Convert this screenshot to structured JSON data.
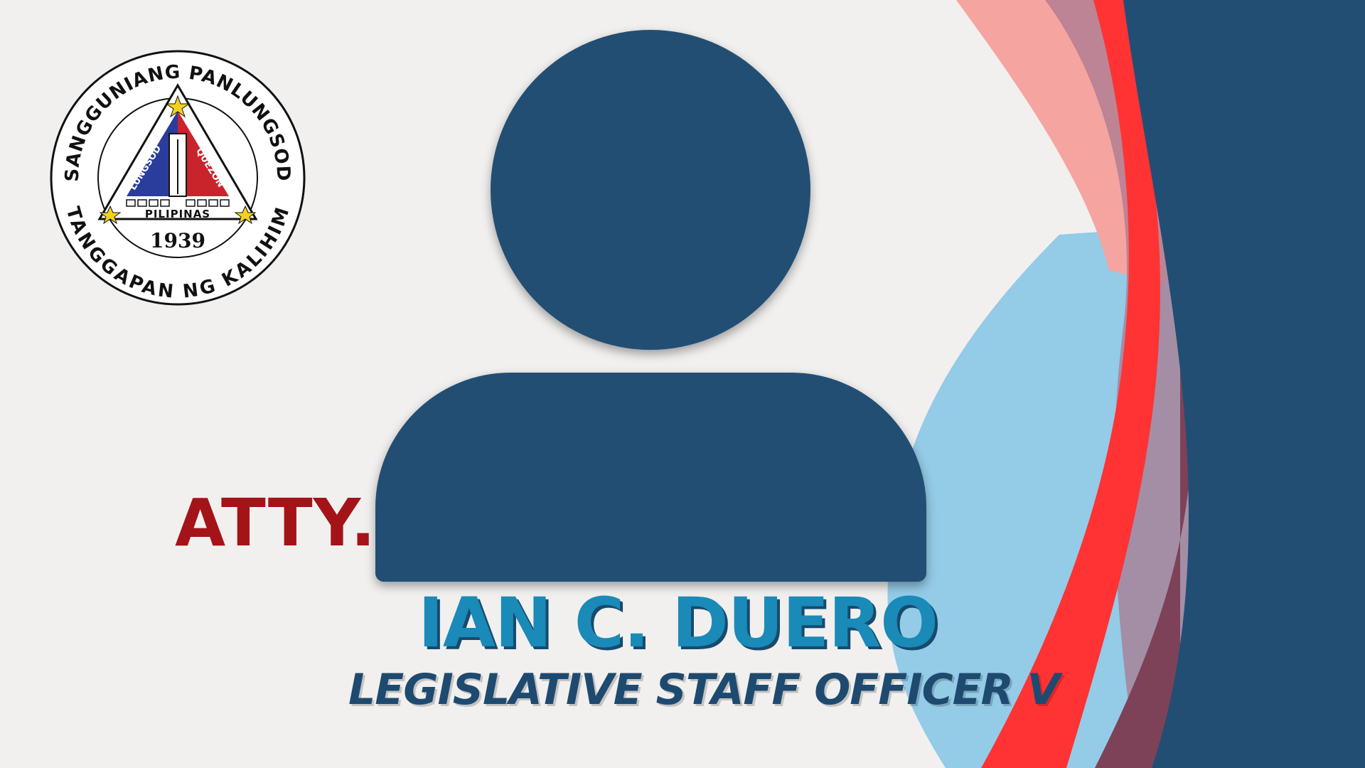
{
  "seal": {
    "top_arc_text": "SANGGUNIANG PANLUNGSOD",
    "bottom_arc_text": "TANGGAPAN NG KALIHIM",
    "left_inner_text": "LUNGSOD",
    "right_inner_text": "QUEZON",
    "country_text": "PILIPINAS",
    "year": "1939"
  },
  "profile": {
    "honorific": "ATTY.",
    "name": "IAN C. DUERO",
    "position": "LEGISLATIVE STAFF OFFICER V"
  },
  "colors": {
    "background": "#f1f0ee",
    "navy": "#224e74",
    "crimson": "#a31318",
    "bright_red": "#ff3333",
    "sky_blue": "#8ec8e6",
    "salmon": "#f6a4a0",
    "name_blue": "#1a8ab8"
  },
  "icons": {
    "avatar": "person-silhouette-icon",
    "star": "star-icon",
    "seal": "city-seal-logo"
  }
}
